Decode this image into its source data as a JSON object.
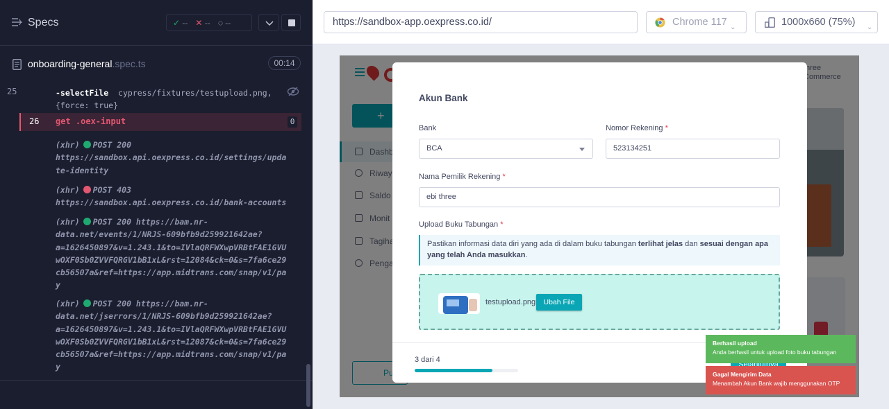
{
  "specs": {
    "title": "Specs",
    "passed": "--",
    "failed": "--",
    "pending": "--"
  },
  "file": {
    "name": "onboarding-general",
    "ext": ".spec.ts",
    "duration": "00:14"
  },
  "commands": {
    "row25_num": "25",
    "row25_cmd": "-selectFile",
    "row25_arg1": "cypress/fixtures/testupload.png,",
    "row25_arg2": "{force: true}",
    "row26_num": "26",
    "row26_cmd": "get  .oex-input",
    "row26_count": "0",
    "xhr_label": "(xhr)",
    "xhr1_method": "POST 200",
    "xhr1_url_a": "https://sandbox.api.oexpress.co.id/settings/upda",
    "xhr1_url_b": "te-identity",
    "xhr2_method": "POST 403",
    "xhr2_url_a": "https://sandbox.api.oexpress.co.id/bank-accounts",
    "xhr3_method": "POST 200 https://bam.nr-",
    "xhr3_url_a": "data.net/events/1/NRJS-609bfb9d259921642ae?",
    "xhr3_url_b": "a=1626450897&v=1.243.1&to=IVlaQRFWXwpVRBtFAE1GVU",
    "xhr3_url_c": "wOXF0Sb0ZVVFQRGV1bB1xL&rst=12084&ck=0&s=7fa6ce29",
    "xhr3_url_d": "cb56507a&ref=https://app.midtrans.com/snap/v1/pa",
    "xhr3_url_e": "y",
    "xhr4_method": "POST 200 https://bam.nr-",
    "xhr4_url_a": "data.net/jserrors/1/NRJS-609bfb9d259921642ae?",
    "xhr4_url_b": "a=1626450897&v=1.243.1&to=IVlaQRFWXwpVRBtFAE1GVU",
    "xhr4_url_c": "wOXF0Sb0ZVVFQRGV1bB1xL&rst=12087&ck=0&s=7fa6ce29",
    "xhr4_url_d": "cb56507a&ref=https://app.midtrans.com/snap/v1/pa",
    "xhr4_url_e": "y"
  },
  "topbar": {
    "url": "https://sandbox-app.oexpress.co.id/",
    "browser": "Chrome 117",
    "viewport": "1000x660",
    "zoom": "(75%)"
  },
  "app": {
    "add_symbol": "+",
    "nav": [
      "Dashb",
      "Riway",
      "Saldo",
      "Monit",
      "Tagiha",
      "Penga"
    ],
    "user_line1": "three",
    "user_line2": "Commerce",
    "pub_label": "Pu"
  },
  "modal": {
    "title": "Akun Bank",
    "bank_label": "Bank",
    "bank_value": "BCA",
    "rek_label": "Nomor Rekening",
    "rek_value": "523134251",
    "owner_label": "Nama Pemilik Rekening",
    "owner_value": "ebi three",
    "upload_label": "Upload Buku Tabungan",
    "required_mark": "*",
    "notice_a": "Pastikan informasi data diri yang ada di dalam buku tabungan ",
    "notice_b": "terlihat jelas",
    "notice_c": " dan ",
    "notice_d": "sesuai dengan apa yang telah Anda masukkan",
    "notice_e": ".",
    "file_name": "testupload.png",
    "change_file": "Ubah File",
    "step": "3 dari 4",
    "step_progress": 0.75,
    "next_label": "Selanjutnya"
  },
  "toasts": {
    "ok_title": "Berhasil upload",
    "ok_msg": "Anda berhasil untuk upload foto buku tabungan",
    "err_title": "Gagal Mengirim Data",
    "err_msg": "Menambah Akun Bank wajib menggunakan OTP"
  },
  "colors": {
    "accent": "#0aa6b5",
    "pass": "#1fa971",
    "fail": "#e45770",
    "toast_ok": "#5cb85c",
    "toast_err": "#d9534f"
  }
}
